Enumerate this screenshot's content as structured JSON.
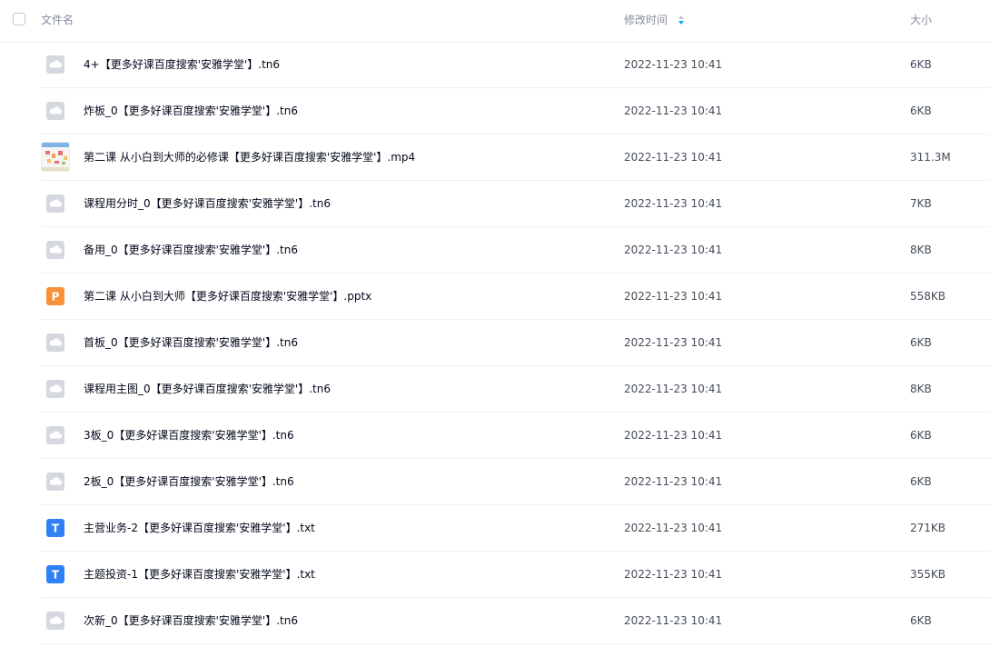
{
  "header": {
    "name_label": "文件名",
    "time_label": "修改时间",
    "size_label": "大小"
  },
  "colors": {
    "generic_icon": "#d5d8de",
    "pptx_icon": "#f7923a",
    "txt_icon": "#2f80f7",
    "sort_active": "#06a7ff"
  },
  "files": [
    {
      "name": "4+【更多好课百度搜索'安雅学堂'】.tn6",
      "time": "2022-11-23 10:41",
      "size": "6KB",
      "icon": "generic-file-icon"
    },
    {
      "name": "炸板_0【更多好课百度搜索'安雅学堂'】.tn6",
      "time": "2022-11-23 10:41",
      "size": "6KB",
      "icon": "generic-file-icon"
    },
    {
      "name": "第二课 从小白到大师的必修课【更多好课百度搜索'安雅学堂'】.mp4",
      "time": "2022-11-23 10:41",
      "size": "311.3M",
      "icon": "video-thumbnail"
    },
    {
      "name": "课程用分时_0【更多好课百度搜索'安雅学堂'】.tn6",
      "time": "2022-11-23 10:41",
      "size": "7KB",
      "icon": "generic-file-icon"
    },
    {
      "name": "备用_0【更多好课百度搜索'安雅学堂'】.tn6",
      "time": "2022-11-23 10:41",
      "size": "8KB",
      "icon": "generic-file-icon"
    },
    {
      "name": "第二课 从小白到大师【更多好课百度搜索'安雅学堂'】.pptx",
      "time": "2022-11-23 10:41",
      "size": "558KB",
      "icon": "pptx-file-icon",
      "icon_letter": "P"
    },
    {
      "name": "首板_0【更多好课百度搜索'安雅学堂'】.tn6",
      "time": "2022-11-23 10:41",
      "size": "6KB",
      "icon": "generic-file-icon"
    },
    {
      "name": "课程用主图_0【更多好课百度搜索'安雅学堂'】.tn6",
      "time": "2022-11-23 10:41",
      "size": "8KB",
      "icon": "generic-file-icon"
    },
    {
      "name": "3板_0【更多好课百度搜索'安雅学堂'】.tn6",
      "time": "2022-11-23 10:41",
      "size": "6KB",
      "icon": "generic-file-icon"
    },
    {
      "name": "2板_0【更多好课百度搜索'安雅学堂'】.tn6",
      "time": "2022-11-23 10:41",
      "size": "6KB",
      "icon": "generic-file-icon"
    },
    {
      "name": "主营业务-2【更多好课百度搜索'安雅学堂'】.txt",
      "time": "2022-11-23 10:41",
      "size": "271KB",
      "icon": "txt-file-icon",
      "icon_letter": "T"
    },
    {
      "name": "主题投资-1【更多好课百度搜索'安雅学堂'】.txt",
      "time": "2022-11-23 10:41",
      "size": "355KB",
      "icon": "txt-file-icon",
      "icon_letter": "T"
    },
    {
      "name": "次新_0【更多好课百度搜索'安雅学堂'】.tn6",
      "time": "2022-11-23 10:41",
      "size": "6KB",
      "icon": "generic-file-icon"
    }
  ]
}
